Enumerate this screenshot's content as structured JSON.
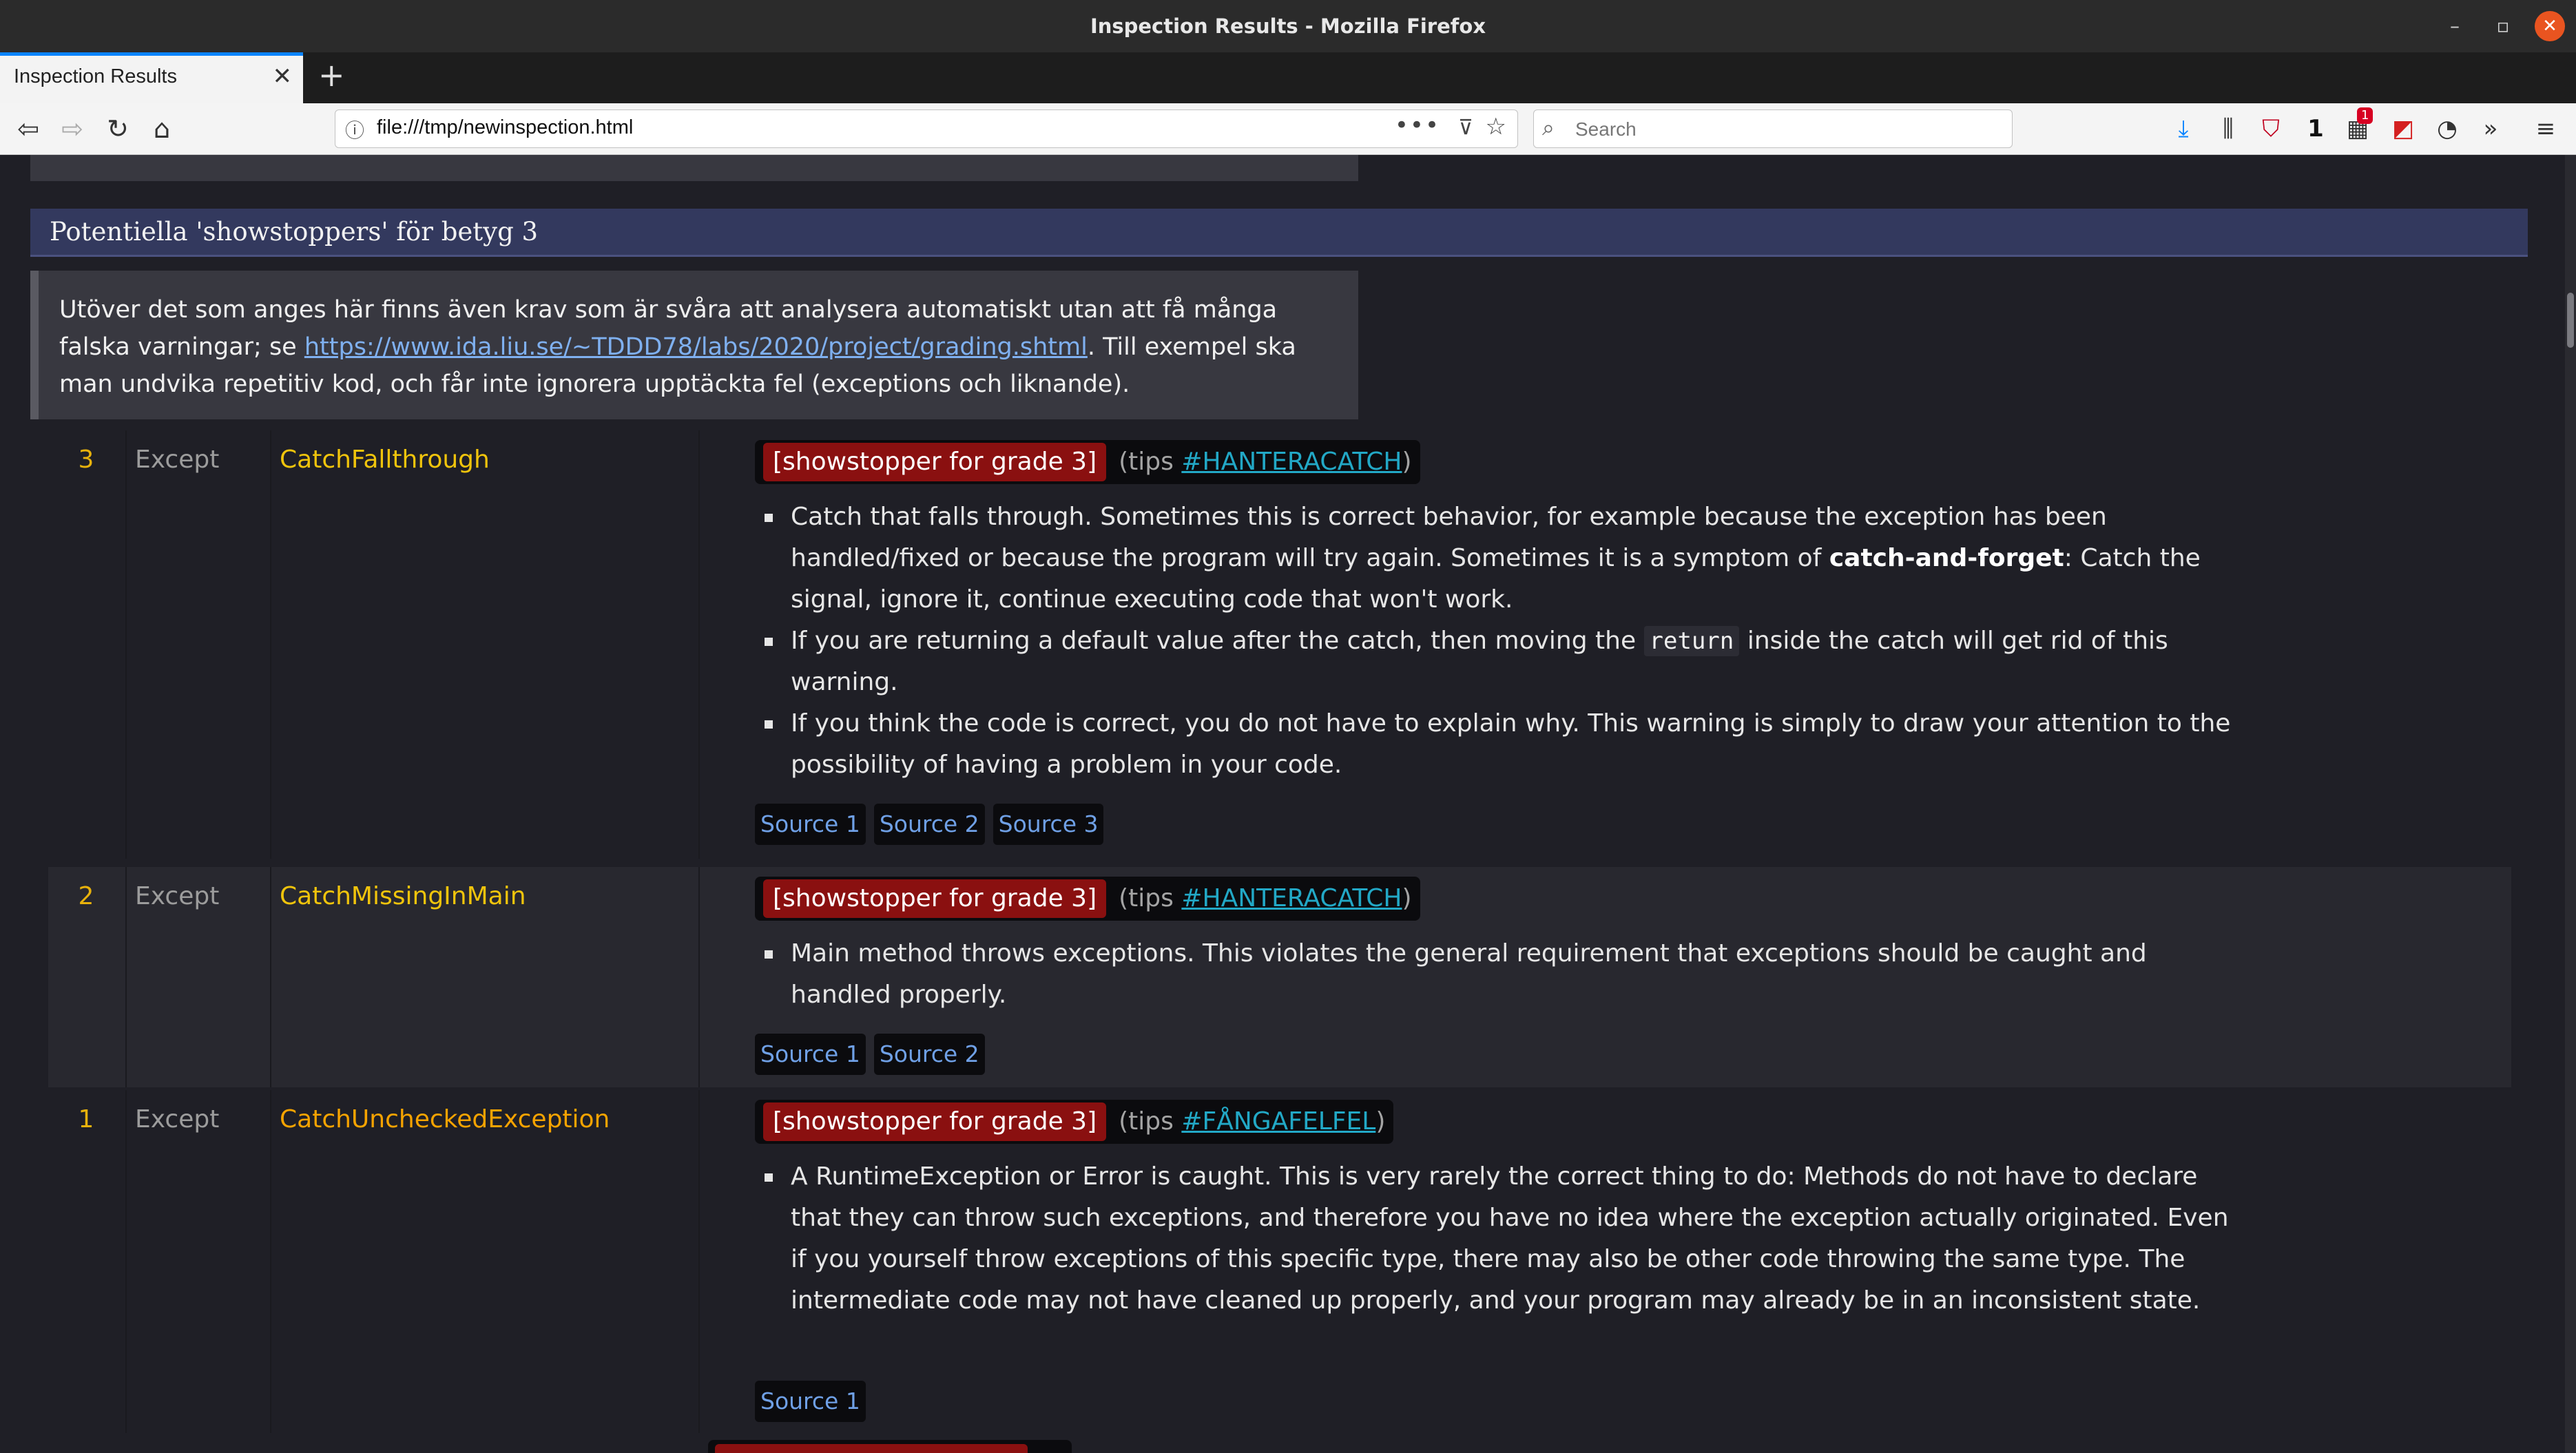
{
  "window": {
    "title": "Inspection Results - Mozilla Firefox"
  },
  "tab": {
    "title": "Inspection Results",
    "close": "✕",
    "new_tab": "+"
  },
  "nav": {
    "url": "file:///tmp/newinspection.html",
    "search_placeholder": "Search",
    "page_actions": "•••",
    "badge_count": "1",
    "toolbar_count": "1"
  },
  "section": {
    "title": "Potentiella 'showstoppers' för betyg 3",
    "note": {
      "before": "Utöver det som anges här finns även krav som är svåra att analysera automatiskt utan att få många falska varningar; se ",
      "link": "https://www.ida.liu.se/~TDDD78/labs/2020/project/grading.shtml",
      "after": ". Till exempel ska man undvika repetitiv kod, och får inte ignorera upptäckta fel (exceptions och liknande)."
    }
  },
  "rows": [
    {
      "num": "3",
      "category": "Except",
      "name": "CatchFallthrough",
      "tag": "[showstopper for grade 3]",
      "tips_prefix": "(tips ",
      "tips_link": "#HANTERACATCH",
      "tips_suffix": ")",
      "bullets": [
        {
          "a": "Catch that falls through. Sometimes this is correct behavior, for example because the exception has been handled/fixed or because the program will try again. Sometimes it is a symptom of ",
          "b": "catch-and-forget",
          "c": ": Catch the signal, ignore it, continue executing code that won't work."
        },
        {
          "a": "If you are returning a default value after the catch, then moving the ",
          "code": "return",
          "c": " inside the catch will get rid of this warning."
        },
        {
          "a": "If you think the code is correct, you do not have to explain why. This warning is simply to draw your attention to the possibility of having a problem in your code."
        }
      ],
      "sources": [
        "Source 1",
        "Source 2",
        "Source 3"
      ]
    },
    {
      "num": "2",
      "category": "Except",
      "name": "CatchMissingInMain",
      "tag": "[showstopper for grade 3]",
      "tips_prefix": "(tips ",
      "tips_link": "#HANTERACATCH",
      "tips_suffix": ")",
      "bullets": [
        {
          "a": "Main method throws exceptions. This violates the general requirement that exceptions should be caught and handled properly."
        }
      ],
      "sources": [
        "Source 1",
        "Source 2"
      ]
    },
    {
      "num": "1",
      "category": "Except",
      "name": "CatchUncheckedException",
      "tag": "[showstopper for grade 3]",
      "tips_prefix": "(tips ",
      "tips_link": "#FÅNGAFELFEL",
      "tips_suffix": ")",
      "bullets": [
        {
          "a": "A RuntimeException or Error is caught. This is very rarely the correct thing to do: Methods do not have to declare that they can throw such exceptions, and therefore you have no idea where the exception actually originated. Even if you yourself throw exceptions of this specific type, there may also be other code throwing the same type. The intermediate code may not have cleaned up properly, and your program may already be in an inconsistent state."
        }
      ],
      "sources": [
        "Source 1"
      ]
    }
  ]
}
